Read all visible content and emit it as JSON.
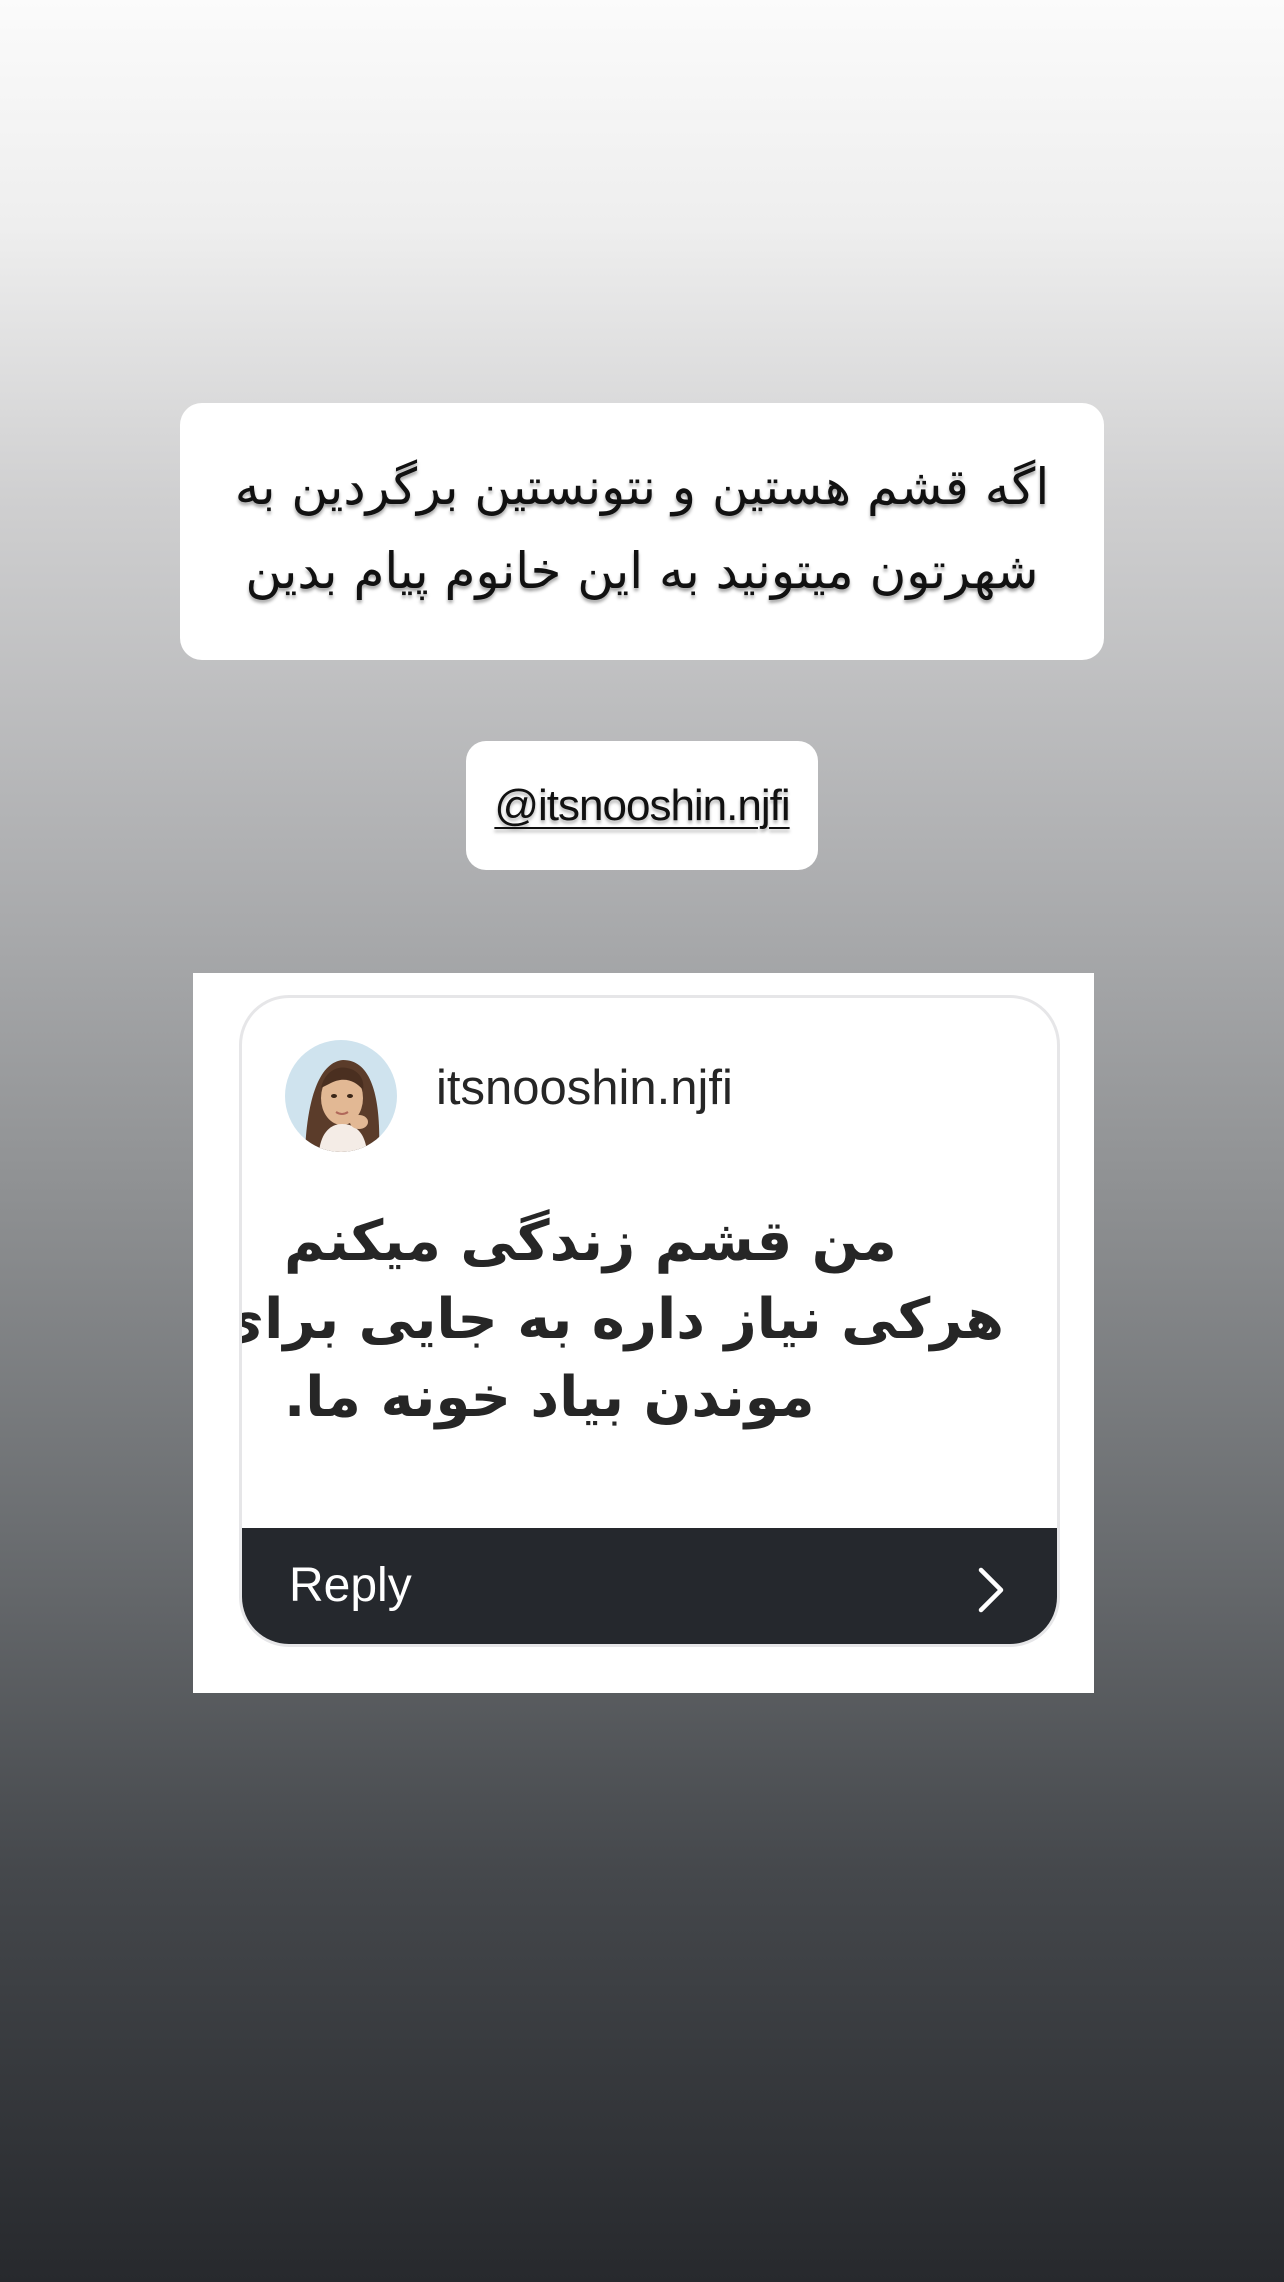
{
  "story": {
    "caption_lines": [
      "اگه قشم هستین و نتونستین برگردین به",
      "شهرتون میتونید به این خانوم پیام بدین"
    ],
    "mention": "@itsnooshin.njfi"
  },
  "question_card": {
    "username": "itsnooshin.njfi",
    "message_lines": [
      "من قشم زندگی میکنم",
      "هرکی نیاز داره به جایی برای",
      "موندن بیاد خونه ما."
    ],
    "reply_label": "Reply",
    "avatar_icon": "profile-photo",
    "reply_icon": "chevron-right-icon"
  },
  "colors": {
    "gradient_top": "#fbfbfb",
    "gradient_bottom": "#27292d",
    "reply_bar": "#25282d",
    "card_border": "#e6e6e8",
    "text_dark": "#262626"
  }
}
